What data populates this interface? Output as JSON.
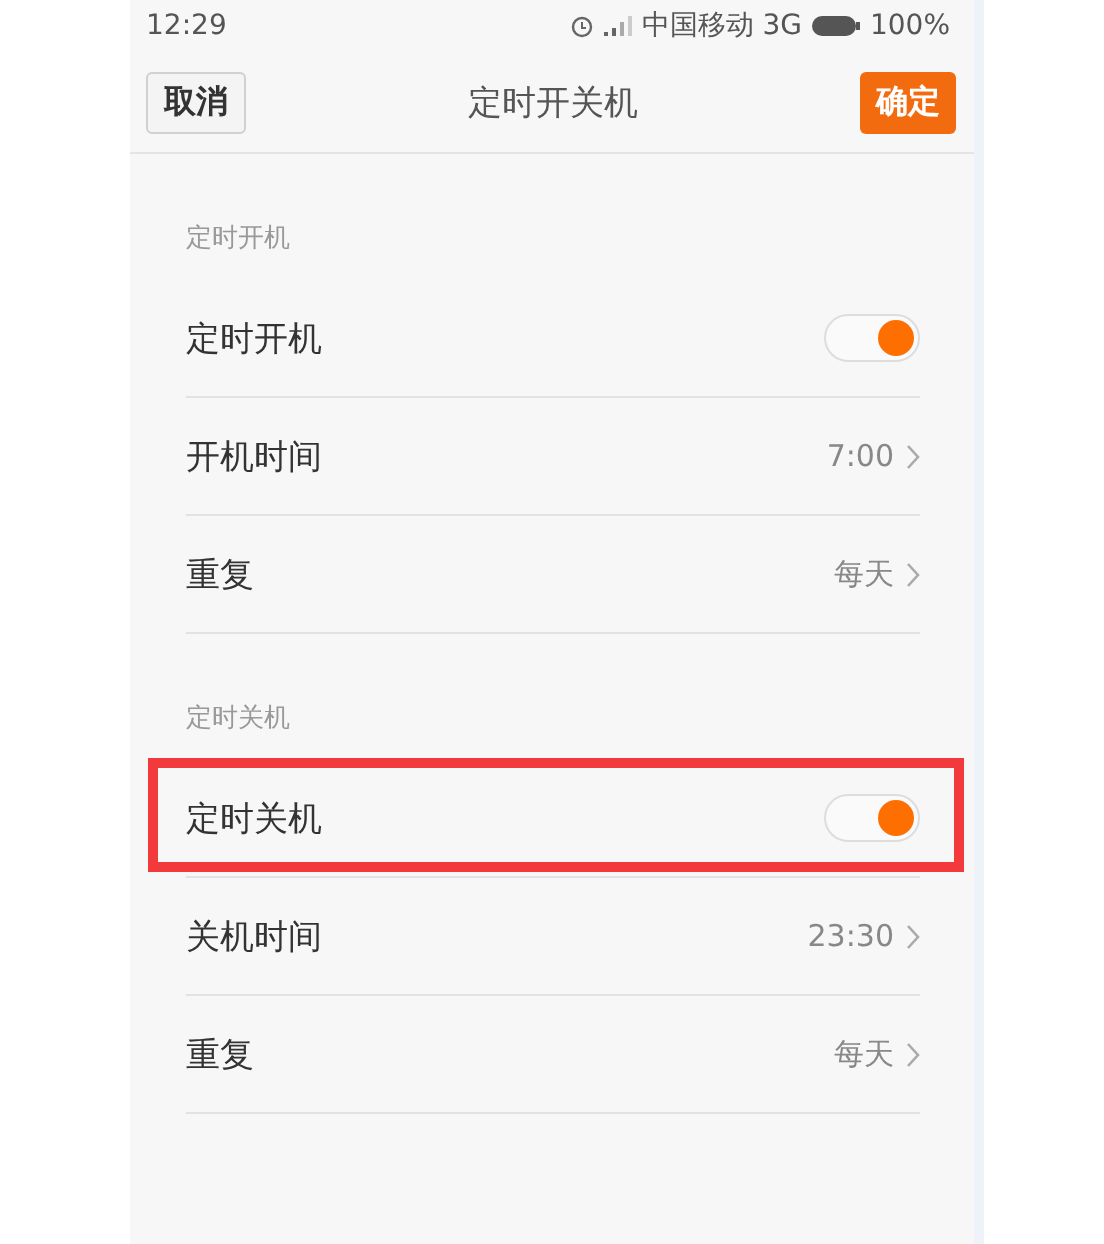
{
  "status_bar": {
    "time": "12:29",
    "carrier": "中国移动 3G",
    "battery": "100%"
  },
  "header": {
    "cancel": "取消",
    "title": "定时开关机",
    "confirm": "确定"
  },
  "sections": [
    {
      "title": "定时开机",
      "rows": [
        {
          "kind": "toggle",
          "label": "定时开机",
          "on": true,
          "highlighted": false
        },
        {
          "kind": "value",
          "label": "开机时间",
          "value": "7:00",
          "highlighted": false
        },
        {
          "kind": "value",
          "label": "重复",
          "value": "每天",
          "highlighted": false
        }
      ]
    },
    {
      "title": "定时关机",
      "rows": [
        {
          "kind": "toggle",
          "label": "定时关机",
          "on": true,
          "highlighted": true
        },
        {
          "kind": "value",
          "label": "关机时间",
          "value": "23:30",
          "highlighted": false
        },
        {
          "kind": "value",
          "label": "重复",
          "value": "每天",
          "highlighted": false
        }
      ]
    }
  ]
}
